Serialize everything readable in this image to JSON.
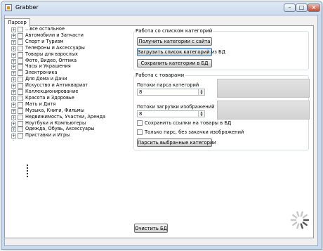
{
  "window": {
    "title": "Grabber"
  },
  "tabs": [
    {
      "label": "Парсер"
    }
  ],
  "tree": {
    "items": [
      {
        "label": "...все остальное"
      },
      {
        "label": "Автомобили и Запчасти"
      },
      {
        "label": "Спорт и Туризм"
      },
      {
        "label": "Телефоны и Аксессуары"
      },
      {
        "label": "Товары для взрослых"
      },
      {
        "label": "Фото, Видео, Оптика"
      },
      {
        "label": "Часы и Украшения"
      },
      {
        "label": "Электроника"
      },
      {
        "label": "Для Дома и Дачи"
      },
      {
        "label": "Искусство и Антиквариат"
      },
      {
        "label": "Коллекционирование"
      },
      {
        "label": "Красота и Здоровье"
      },
      {
        "label": "Мать и Дитя"
      },
      {
        "label": "Музыка, Книги, Фильмы"
      },
      {
        "label": "Недвижимость, Участки, Аренда"
      },
      {
        "label": "Ноутбуки и Компьютеры"
      },
      {
        "label": "Одежда, Обувь, Аксессуары"
      },
      {
        "label": "Приставки и Игры"
      }
    ]
  },
  "categories_group": {
    "title": "Работа со списком категорий",
    "get_button": "Получить категории с сайта",
    "load_button": "Загрузить список категорий из БД",
    "save_button": "Сохранить категории в БД"
  },
  "products_group": {
    "title": "Работа с товарами",
    "parse_threads_label": "Потоки парса категорий",
    "parse_threads_value": "8",
    "image_threads_label": "Потоки загрузки изображений",
    "image_threads_value": "8",
    "save_links_label": "Сохранить ссылки на товары в БД",
    "parse_only_label": "Только парс, без закачки изображений",
    "parse_button": "Парсить выбранные категории"
  },
  "footer": {
    "clear_db_button": "Очистить БД"
  }
}
